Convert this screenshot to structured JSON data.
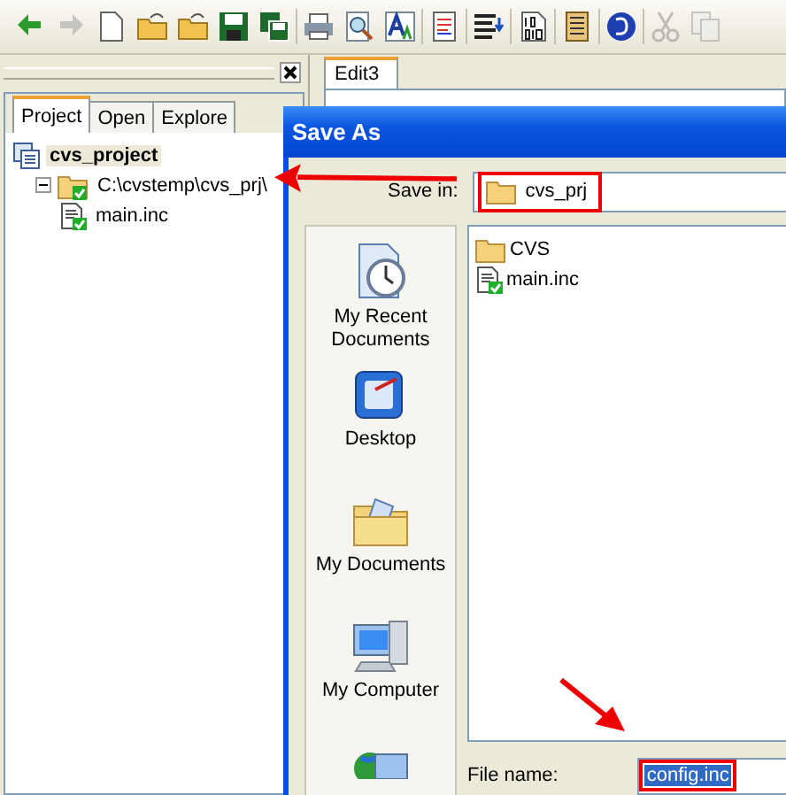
{
  "toolbar": {
    "buttons": [
      {
        "kind": "back",
        "disabled": false
      },
      {
        "kind": "forward",
        "disabled": true
      },
      {
        "kind": "new",
        "disabled": false
      },
      {
        "kind": "open",
        "disabled": false
      },
      {
        "kind": "open",
        "disabled": false
      },
      {
        "kind": "save",
        "disabled": false
      },
      {
        "kind": "saveall",
        "disabled": false
      },
      {
        "kind": "sep"
      },
      {
        "kind": "print",
        "disabled": false
      },
      {
        "kind": "preview",
        "disabled": false
      },
      {
        "kind": "font",
        "disabled": false
      },
      {
        "kind": "sep"
      },
      {
        "kind": "document",
        "disabled": false
      },
      {
        "kind": "sep"
      },
      {
        "kind": "lines",
        "disabled": false
      },
      {
        "kind": "sep"
      },
      {
        "kind": "binary",
        "disabled": false
      },
      {
        "kind": "sep"
      },
      {
        "kind": "notepad",
        "disabled": false
      },
      {
        "kind": "sep"
      },
      {
        "kind": "globe",
        "disabled": false
      },
      {
        "kind": "sep"
      },
      {
        "kind": "cut",
        "disabled": true
      },
      {
        "kind": "copy",
        "disabled": true
      }
    ]
  },
  "panel": {
    "tabs": [
      {
        "label": "Project",
        "selected": true
      },
      {
        "label": "Open",
        "selected": false
      },
      {
        "label": "Explore",
        "selected": false
      }
    ],
    "tree": [
      {
        "label": "cvs_project",
        "kind": "project",
        "selected": true,
        "children": [
          {
            "label": "C:\\cvstemp\\cvs_prj\\",
            "kind": "folder",
            "selected": false,
            "expanded": true,
            "children": [
              {
                "label": "main.inc",
                "kind": "file",
                "selected": false
              }
            ]
          }
        ]
      }
    ]
  },
  "editor": {
    "tabs": [
      {
        "label": "Edit3",
        "selected": true
      }
    ]
  },
  "dialog": {
    "title": "Save As",
    "save_in": {
      "label": "Save in:",
      "value": "cvs_prj",
      "highlighted": true
    },
    "places": [
      {
        "label": "My Recent Documents",
        "kind": "recent"
      },
      {
        "label": "Desktop",
        "kind": "desktop"
      },
      {
        "label": "My Documents",
        "kind": "documents"
      },
      {
        "label": "My Computer",
        "kind": "computer"
      },
      {
        "kind": "network"
      }
    ],
    "files": [
      {
        "name": "CVS",
        "kind": "folder"
      },
      {
        "name": "main.inc",
        "kind": "file"
      }
    ],
    "file_name": {
      "label": "File name:",
      "value": "config.inc",
      "selected": true,
      "highlighted": true
    }
  }
}
